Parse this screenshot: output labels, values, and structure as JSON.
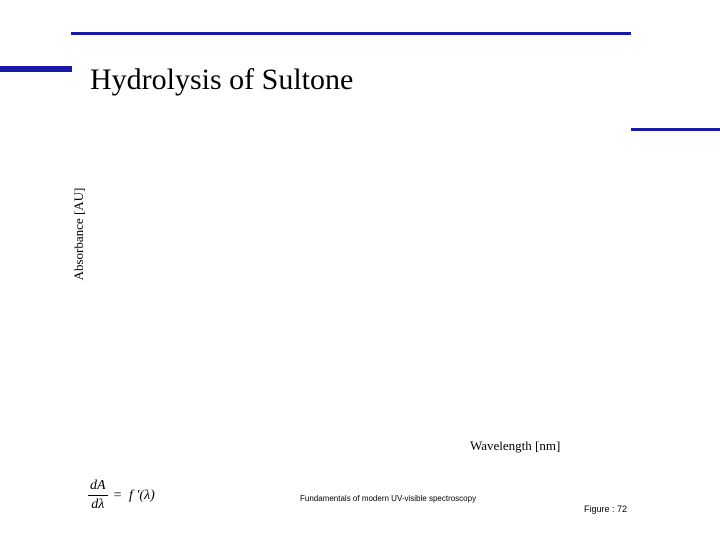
{
  "slide": {
    "title": "Hydrolysis of Sultone",
    "y_axis_label": "Absorbance [AU]",
    "x_axis_label": "Wavelength [nm]",
    "formula": {
      "numerator": "dA",
      "denominator": "dλ",
      "equals": "=",
      "rhs": "f ′(λ)"
    },
    "footer_source": "Fundamentals of modern UV-visible spectroscopy",
    "footer_figure": "Figure : 72"
  },
  "colors": {
    "accent_bars": "#1a1aa8",
    "background": "#ffffff",
    "text": "#000000"
  }
}
